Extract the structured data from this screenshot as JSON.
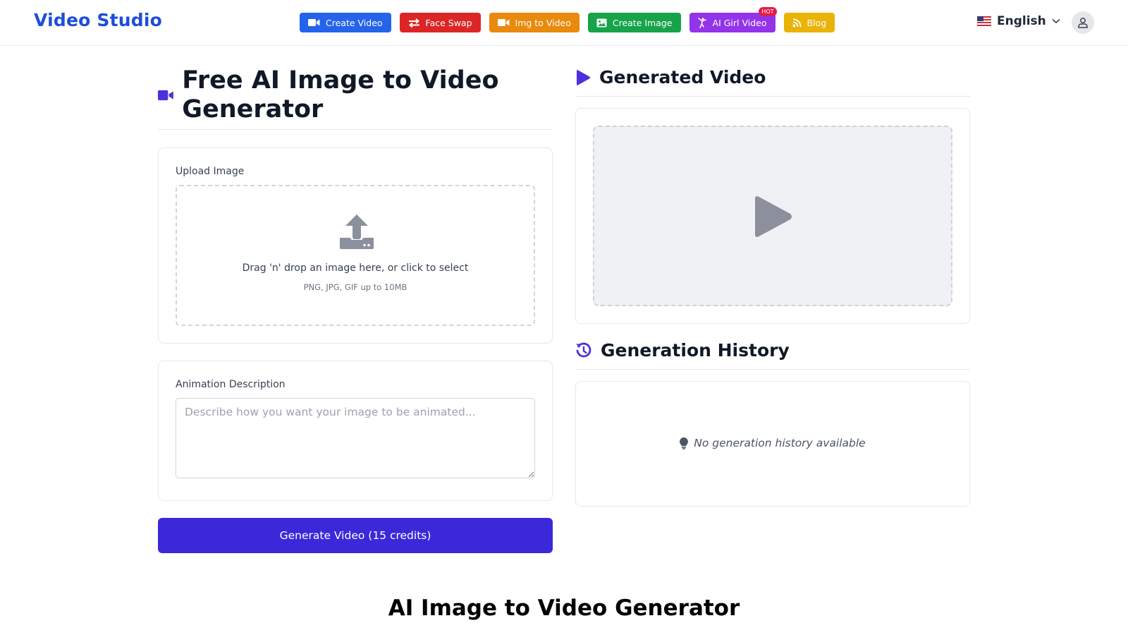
{
  "header": {
    "logo": "Video Studio",
    "nav": [
      {
        "label": "Create Video",
        "icon": "video-camera-icon",
        "color": "#2563eb"
      },
      {
        "label": "Face Swap",
        "icon": "swap-arrows-icon",
        "color": "#dc2626"
      },
      {
        "label": "Img to Video",
        "icon": "video-camera-icon",
        "color": "#ea8a0c"
      },
      {
        "label": "Create Image",
        "icon": "image-icon",
        "color": "#16a34a"
      },
      {
        "label": "AI Girl Video",
        "icon": "dancer-icon",
        "color": "#9333ea",
        "badge": "HOT"
      },
      {
        "label": "Blog",
        "icon": "rss-icon",
        "color": "#eab308"
      }
    ],
    "language": "English",
    "language_flag": "us-flag-icon"
  },
  "main": {
    "title": "Free AI Image to Video Generator",
    "upload": {
      "label": "Upload Image",
      "drop_text": "Drag 'n' drop an image here, or click to select",
      "drop_hint": "PNG, JPG, GIF up to 10MB"
    },
    "description": {
      "label": "Animation Description",
      "placeholder": "Describe how you want your image to be animated...",
      "value": ""
    },
    "generate_button": "Generate Video (15 credits)"
  },
  "sidebar": {
    "generated_video_title": "Generated Video",
    "history_title": "Generation History",
    "history_empty": "No generation history available"
  },
  "footer_section": {
    "title": "AI Image to Video Generator"
  },
  "colors": {
    "accent": "#3b28d9",
    "logo": "#1d4ed8"
  }
}
